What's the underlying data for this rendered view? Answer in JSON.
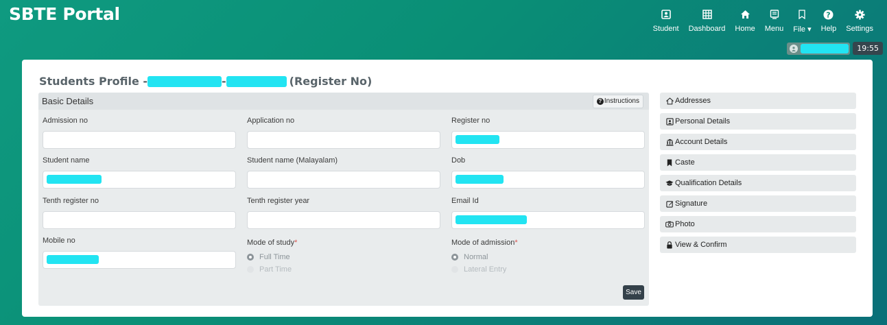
{
  "app": {
    "title": "SBTE Portal"
  },
  "topnav": [
    {
      "label": "Student",
      "icon": "student-icon"
    },
    {
      "label": "Dashboard",
      "icon": "dashboard-icon"
    },
    {
      "label": "Home",
      "icon": "home-icon"
    },
    {
      "label": "Menu",
      "icon": "menu-icon"
    },
    {
      "label": "File",
      "icon": "bookmark-icon",
      "dropdown": true
    },
    {
      "label": "Help",
      "icon": "help-icon"
    },
    {
      "label": "Settings",
      "icon": "gear-icon"
    }
  ],
  "user_bar": {
    "time": "19:55"
  },
  "page": {
    "title_prefix": "Students Profile -",
    "title_sep": "-",
    "title_suffix": "(Register No)"
  },
  "basic_details": {
    "title": "Basic Details",
    "instructions_label": "Instructions",
    "fields": {
      "admission_no": {
        "label": "Admission no",
        "value": ""
      },
      "application_no": {
        "label": "Application no",
        "value": ""
      },
      "register_no": {
        "label": "Register no",
        "value": ""
      },
      "student_name": {
        "label": "Student name",
        "value": ""
      },
      "student_name_ml": {
        "label": "Student name (Malayalam)",
        "value": ""
      },
      "dob": {
        "label": "Dob",
        "value": ""
      },
      "tenth_register_no": {
        "label": "Tenth register no",
        "value": ""
      },
      "tenth_register_year": {
        "label": "Tenth register year",
        "value": ""
      },
      "email_id": {
        "label": "Email Id",
        "value": ""
      },
      "mobile_no": {
        "label": "Mobile no",
        "value": ""
      }
    },
    "mode_of_study": {
      "label": "Mode of study",
      "required_mark": "*",
      "options": [
        "Full Time",
        "Part Time"
      ],
      "selected": "Full Time"
    },
    "mode_of_admission": {
      "label": "Mode of admission",
      "required_mark": "*",
      "options": [
        "Normal",
        "Lateral Entry"
      ],
      "selected": "Normal"
    },
    "save_label": "Save"
  },
  "sidebar": {
    "items": [
      {
        "label": "Addresses",
        "icon": "home-outline-icon"
      },
      {
        "label": "Personal Details",
        "icon": "id-card-icon"
      },
      {
        "label": "Account Details",
        "icon": "bank-icon"
      },
      {
        "label": "Caste",
        "icon": "bookmark-icon"
      },
      {
        "label": "Qualification Details",
        "icon": "graduation-cap-icon"
      },
      {
        "label": "Signature",
        "icon": "edit-icon"
      },
      {
        "label": "Photo",
        "icon": "camera-icon"
      },
      {
        "label": "View & Confirm",
        "icon": "lock-icon"
      }
    ]
  },
  "colors": {
    "accent": "#0f9a80",
    "redaction": "#22e4f2",
    "save_button": "#34414a"
  }
}
